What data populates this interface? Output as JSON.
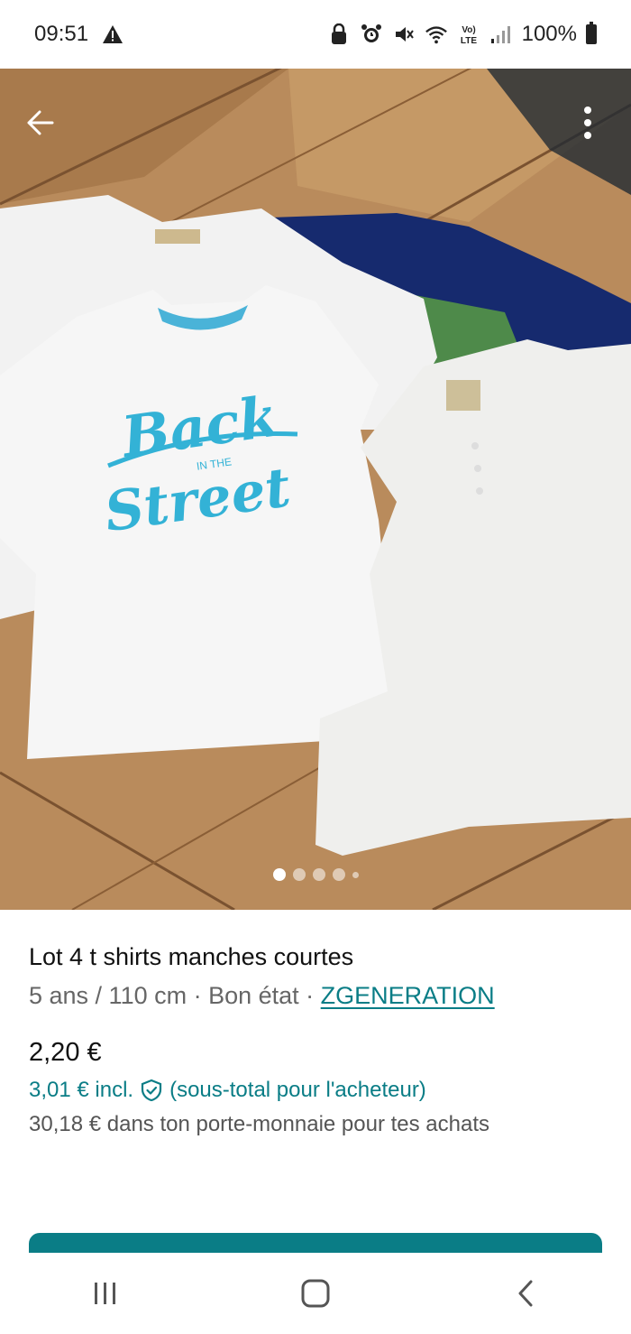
{
  "status_bar": {
    "time": "09:51",
    "battery": "100%",
    "icons": [
      "warning-icon",
      "lock-icon",
      "alarm-icon",
      "mute-icon",
      "wifi-icon",
      "volte-icon",
      "signal-icon",
      "battery-icon"
    ],
    "volte_text": "VoLTE"
  },
  "photo": {
    "shirt_print_line1": "Back",
    "shirt_print_line2": "IN THE",
    "shirt_print_line3": "Street",
    "image_count": 5,
    "active_index": 0
  },
  "listing": {
    "title": "Lot 4 t shirts manches courtes",
    "meta": "5 ans / 110 cm · Bon état · ",
    "brand": "ZGENERATION",
    "price": "2,20 €",
    "price_incl": "3,01 €  incl.",
    "price_incl_note": "(sous-total pour l'acheteur)",
    "wallet_note": "30,18 € dans ton porte-monnaie pour tes achats"
  },
  "colors": {
    "accent": "#0a7d86",
    "floor": "#b88a5a"
  }
}
